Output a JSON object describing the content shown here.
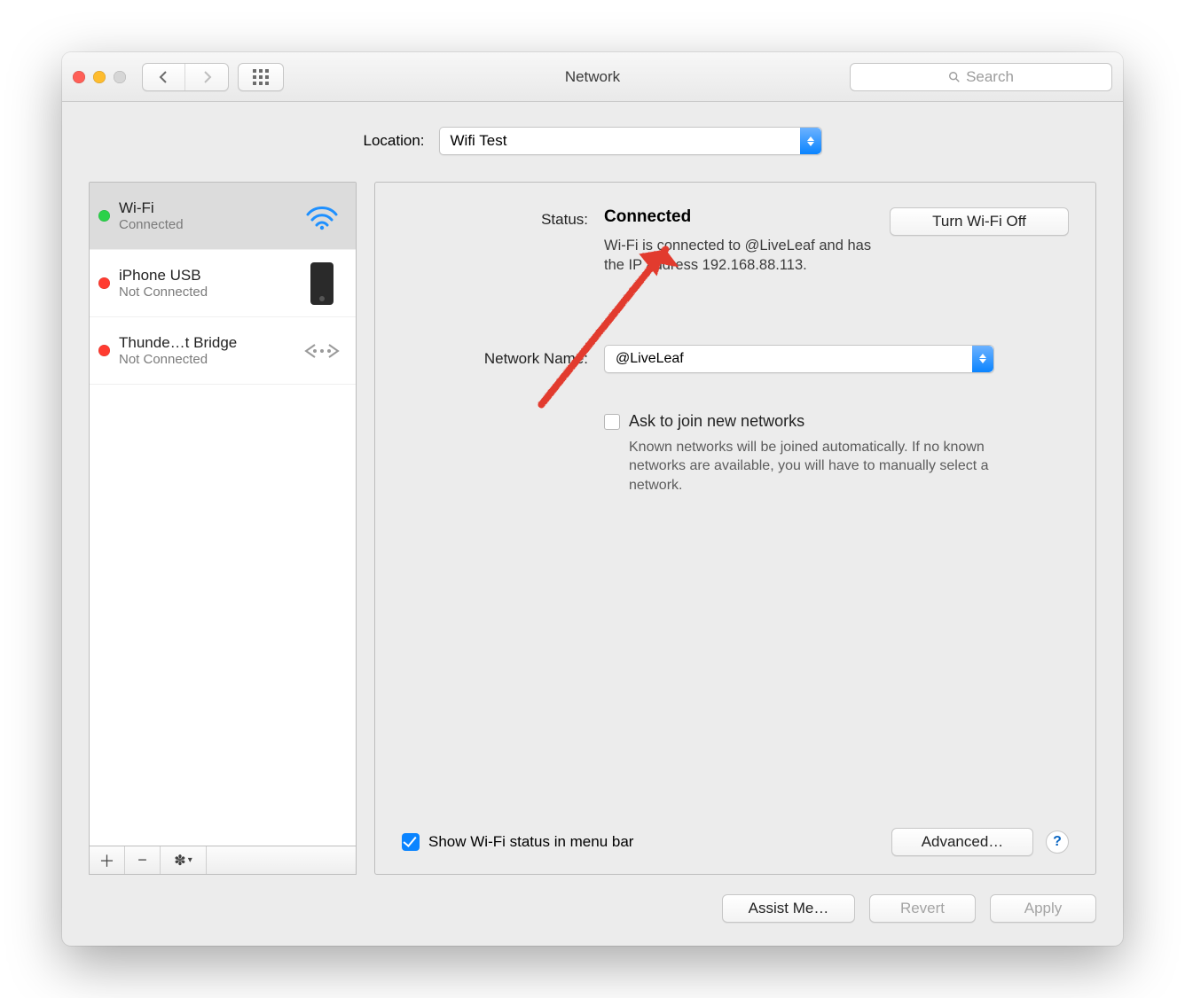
{
  "window": {
    "title": "Network",
    "search_placeholder": "Search"
  },
  "location": {
    "label": "Location:",
    "value": "Wifi Test"
  },
  "sidebar": {
    "items": [
      {
        "name": "Wi-Fi",
        "sub": "Connected",
        "status": "green",
        "icon": "wifi"
      },
      {
        "name": "iPhone USB",
        "sub": "Not Connected",
        "status": "red",
        "icon": "iphone"
      },
      {
        "name": "Thunde…t Bridge",
        "sub": "Not Connected",
        "status": "red",
        "icon": "bridge"
      }
    ],
    "add_tooltip": "+",
    "remove_tooltip": "−",
    "action_tooltip": "⚙︎"
  },
  "main": {
    "status_label": "Status:",
    "status_value": "Connected",
    "status_sub": "Wi-Fi is connected to @LiveLeaf and has the IP address 192.168.88.113.",
    "wifi_toggle": "Turn Wi-Fi Off",
    "network_name_label": "Network Name:",
    "network_name_value": "@LiveLeaf",
    "ask_join_label": "Ask to join new networks",
    "ask_join_sub": "Known networks will be joined automatically. If no known networks are available, you will have to manually select a network.",
    "show_menu_bar_label": "Show Wi-Fi status in menu bar",
    "advanced": "Advanced…",
    "help": "?"
  },
  "footer": {
    "assist": "Assist Me…",
    "revert": "Revert",
    "apply": "Apply"
  }
}
